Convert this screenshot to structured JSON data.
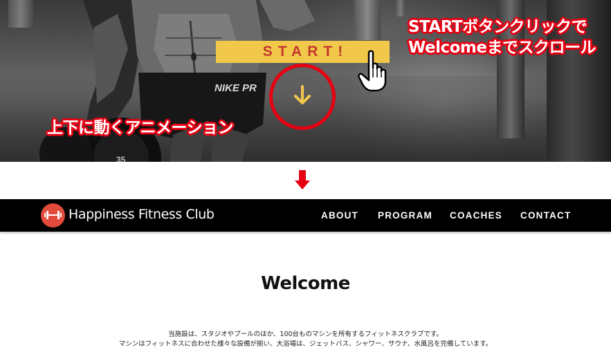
{
  "hero": {
    "start_button_label": "START!",
    "annotation_scroll_line1": "STARTボタンクリックで",
    "annotation_scroll_line2": "Welcomeまでスクロール",
    "annotation_animation": "上下に動くアニメーション",
    "shorts_logo_text": "NIKE PR"
  },
  "header": {
    "brand": "Happiness Fitness Club",
    "nav": [
      {
        "label": "ABOUT"
      },
      {
        "label": "PROGRAM"
      },
      {
        "label": "COACHES"
      },
      {
        "label": "CONTACT"
      }
    ]
  },
  "main": {
    "title": "Welcome",
    "intro_line1": "当施設は、スタジオやプールのほか、100台ものマシンを所有するフィットネスクラブです。",
    "intro_line2": "マシンはフィットネスに合わせた様々な設備が揃い、大浴場は、ジェットバス、シャワー、サウナ、水風呂を完備しています。"
  },
  "colors": {
    "accent_red": "#e60012",
    "button_yellow": "#f2c84b",
    "logo_red": "#e24a3b",
    "nav_bg": "#000000"
  },
  "icons": {
    "hand": "pointing-hand-icon",
    "down": "down-arrow-icon",
    "transition": "red-down-arrow-icon",
    "logo": "dumbbell-icon"
  }
}
